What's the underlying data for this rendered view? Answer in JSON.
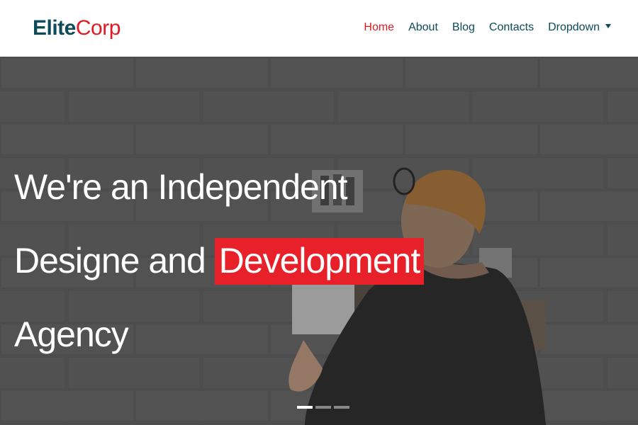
{
  "brand": {
    "part1": "Elite",
    "part2": "Corp"
  },
  "nav": {
    "items": [
      {
        "label": "Home",
        "active": true
      },
      {
        "label": "About",
        "active": false
      },
      {
        "label": "Blog",
        "active": false
      },
      {
        "label": "Contacts",
        "active": false
      },
      {
        "label": "Dropdown",
        "active": false
      }
    ],
    "dropdown_icon": "caret-down-icon"
  },
  "hero": {
    "line1": "We're an Independent",
    "line2_prefix": "Designe and ",
    "line2_highlight": "Development",
    "line3": "Agency",
    "slides_total": 3,
    "active_slide": 1
  },
  "colors": {
    "brand_dark": "#0d4a5a",
    "accent_red": "#e01a22",
    "highlight_red": "#e8202a",
    "white": "#ffffff"
  }
}
